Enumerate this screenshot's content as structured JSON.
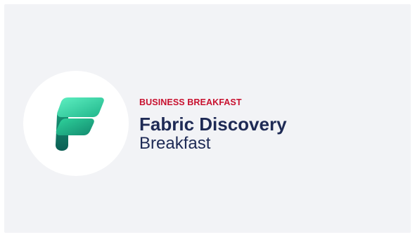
{
  "banner": {
    "eyebrow": "BUSINESS BREAKFAST",
    "title": "Fabric Discovery",
    "subtitle": "Breakfast"
  },
  "logo": {
    "icon": "fabric-logo-icon"
  },
  "colors": {
    "background": "#f2f3f6",
    "eyebrow": "#c8102e",
    "title": "#1e2a55",
    "logo_circle": "#ffffff",
    "logo_gradient_light": "#3ee6b0",
    "logo_gradient_dark": "#0f7a6e"
  }
}
